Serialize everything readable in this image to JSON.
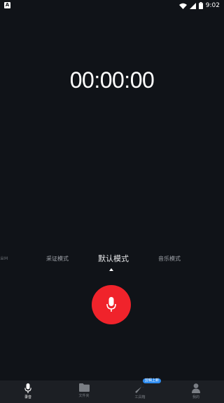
{
  "status_bar": {
    "notification_icon": "A",
    "time": "9:02",
    "icons": [
      "wifi-icon",
      "signal-icon",
      "battery-icon"
    ]
  },
  "timer": {
    "value": "00:00:00"
  },
  "modes": {
    "partial_left": "ㄓM",
    "items": [
      "采证模式",
      "默认模式",
      "音乐模式"
    ],
    "selected": "默认模式"
  },
  "record_button": {
    "icon": "microphone-icon",
    "color": "#f0232b"
  },
  "bottom_nav": {
    "items": [
      {
        "label": "录音",
        "icon": "microphone-icon",
        "active": true
      },
      {
        "label": "文件夹",
        "icon": "folder-icon",
        "active": false
      },
      {
        "label": "工具箱",
        "icon": "wrench-icon",
        "active": false,
        "badge": "剪辑上新"
      },
      {
        "label": "我的",
        "icon": "user-icon",
        "active": false
      }
    ]
  },
  "colors": {
    "background": "#101318",
    "accent_red": "#f0232b",
    "nav_background": "#1c1f24",
    "badge_blue": "#2e8cf0"
  }
}
